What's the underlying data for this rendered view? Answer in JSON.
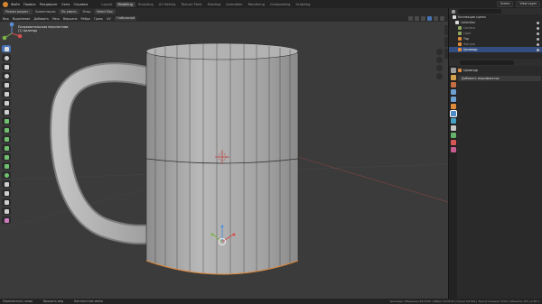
{
  "topbar": {
    "menu": [
      "Файл",
      "Правка",
      "Рендеринг",
      "Окно",
      "Справка"
    ],
    "workspaces": [
      "Layout",
      "Modeling",
      "Sculpting",
      "UV Editing",
      "Texture Paint",
      "Shading",
      "Animation",
      "Rendering",
      "Compositing",
      "Scripting"
    ],
    "active_workspace": "Modeling",
    "scene": "Scene",
    "view_layer": "View Layer"
  },
  "header": {
    "mode": "Режим редакт.",
    "view": "Вид",
    "select": "Выделение",
    "add": "Добавить",
    "mesh": "Меш",
    "vertex": "Вершина",
    "edge": "Ребро",
    "face": "Грань",
    "uv": "UV",
    "orientation": "Ориентация:",
    "orientation_value": "По умолч.",
    "drag": "Drag:",
    "drag_value": "Select Box",
    "global": "Глобальный"
  },
  "viewport": {
    "info_line1": "Пользовательская перспектива",
    "info_line2": "(1) Цилиндр"
  },
  "outliner": {
    "collection_root": "Коллекция сцены",
    "rows": [
      {
        "label": "Collection",
        "color": "#dcdcdc",
        "selected": false,
        "dim": false
      },
      {
        "label": "Camera",
        "color": "#8fa85e",
        "selected": false,
        "dim": true
      },
      {
        "label": "Light",
        "color": "#8fa85e",
        "selected": false,
        "dim": true
      },
      {
        "label": "Тор",
        "color": "#e08a3c",
        "selected": false,
        "dim": false
      },
      {
        "label": "Фигура",
        "color": "#e08a3c",
        "selected": false,
        "dim": true
      },
      {
        "label": "Цилиндр",
        "color": "#e08a3c",
        "selected": true,
        "dim": false
      }
    ]
  },
  "properties": {
    "object_name": "Цилиндр",
    "add_modifier": "Добавить модификатор",
    "tab_colors": [
      "#9e9e9e",
      "#d4a24c",
      "#c76e45",
      "#6fa0d2",
      "#6fa0d2",
      "#e08a3c",
      "#4e8cc7",
      "#45a1c6",
      "#c7c7c7",
      "#66b06a",
      "#d85656",
      "#c75c90"
    ]
  },
  "statusbar": {
    "item1": "Переместить гизмо",
    "item2": "Вращать вид",
    "item3": "Контекстное меню",
    "stats": "Цилиндр | Вершины 64/1590 | Рёбра 32/3130 | Грани 0/1554 | Тригугольники 3104 | Объекты 0/3 | 2.90.1"
  },
  "colors": {
    "viewport_bg": "#3b3b3b",
    "mesh": "#a9a9a9",
    "wire": "#1e1e1e",
    "selection": "#e08a3c",
    "accent": "#4772b3"
  }
}
